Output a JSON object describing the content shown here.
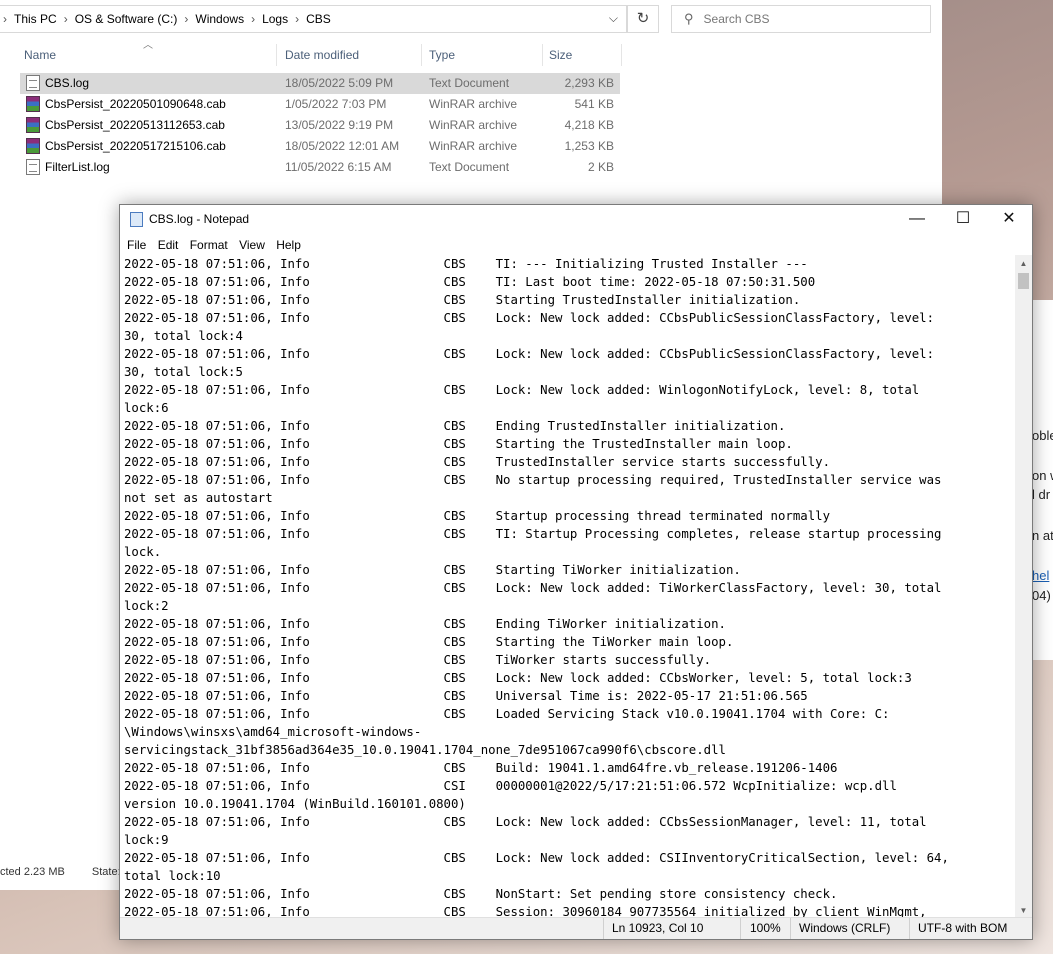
{
  "explorer": {
    "breadcrumb": [
      "This PC",
      "OS & Software (C:)",
      "Windows",
      "Logs",
      "CBS"
    ],
    "search_placeholder": "Search CBS",
    "columns": {
      "name": "Name",
      "date": "Date modified",
      "type": "Type",
      "size": "Size"
    },
    "files": [
      {
        "name": "CBS.log",
        "date": "18/05/2022 5:09 PM",
        "type": "Text Document",
        "size": "2,293 KB",
        "icon": "text-file-icon",
        "selected": true
      },
      {
        "name": "CbsPersist_20220501090648.cab",
        "date": "1/05/2022 7:03 PM",
        "type": "WinRAR archive",
        "size": "541 KB",
        "icon": "winrar-archive-icon",
        "selected": false
      },
      {
        "name": "CbsPersist_20220513112653.cab",
        "date": "13/05/2022 9:19 PM",
        "type": "WinRAR archive",
        "size": "4,218 KB",
        "icon": "winrar-archive-icon",
        "selected": false
      },
      {
        "name": "CbsPersist_20220517215106.cab",
        "date": "18/05/2022 12:01 AM",
        "type": "WinRAR archive",
        "size": "1,253 KB",
        "icon": "winrar-archive-icon",
        "selected": false
      },
      {
        "name": "FilterList.log",
        "date": "11/05/2022 6:15 AM",
        "type": "Text Document",
        "size": "2 KB",
        "icon": "text-file-icon",
        "selected": false
      }
    ],
    "status_selected": "cted  2.23 MB",
    "status_state": "State:"
  },
  "browser_peek": {
    "lines": [
      "oble",
      "on w",
      "l dr",
      "n at",
      "hel",
      "04)"
    ]
  },
  "notepad": {
    "title": "CBS.log - Notepad",
    "menu": [
      "File",
      "Edit",
      "Format",
      "View",
      "Help"
    ],
    "lines": [
      "2022-05-18 07:51:06, Info                  CBS    TI: --- Initializing Trusted Installer ---",
      "2022-05-18 07:51:06, Info                  CBS    TI: Last boot time: 2022-05-18 07:50:31.500",
      "2022-05-18 07:51:06, Info                  CBS    Starting TrustedInstaller initialization.",
      "2022-05-18 07:51:06, Info                  CBS    Lock: New lock added: CCbsPublicSessionClassFactory, level:",
      "30, total lock:4",
      "2022-05-18 07:51:06, Info                  CBS    Lock: New lock added: CCbsPublicSessionClassFactory, level:",
      "30, total lock:5",
      "2022-05-18 07:51:06, Info                  CBS    Lock: New lock added: WinlogonNotifyLock, level: 8, total",
      "lock:6",
      "2022-05-18 07:51:06, Info                  CBS    Ending TrustedInstaller initialization.",
      "2022-05-18 07:51:06, Info                  CBS    Starting the TrustedInstaller main loop.",
      "2022-05-18 07:51:06, Info                  CBS    TrustedInstaller service starts successfully.",
      "2022-05-18 07:51:06, Info                  CBS    No startup processing required, TrustedInstaller service was",
      "not set as autostart",
      "2022-05-18 07:51:06, Info                  CBS    Startup processing thread terminated normally",
      "2022-05-18 07:51:06, Info                  CBS    TI: Startup Processing completes, release startup processing",
      "lock.",
      "2022-05-18 07:51:06, Info                  CBS    Starting TiWorker initialization.",
      "2022-05-18 07:51:06, Info                  CBS    Lock: New lock added: TiWorkerClassFactory, level: 30, total",
      "lock:2",
      "2022-05-18 07:51:06, Info                  CBS    Ending TiWorker initialization.",
      "2022-05-18 07:51:06, Info                  CBS    Starting the TiWorker main loop.",
      "2022-05-18 07:51:06, Info                  CBS    TiWorker starts successfully.",
      "2022-05-18 07:51:06, Info                  CBS    Lock: New lock added: CCbsWorker, level: 5, total lock:3",
      "2022-05-18 07:51:06, Info                  CBS    Universal Time is: 2022-05-17 21:51:06.565",
      "2022-05-18 07:51:06, Info                  CBS    Loaded Servicing Stack v10.0.19041.1704 with Core: C:",
      "\\Windows\\winsxs\\amd64_microsoft-windows-",
      "servicingstack_31bf3856ad364e35_10.0.19041.1704_none_7de951067ca990f6\\cbscore.dll",
      "2022-05-18 07:51:06, Info                  CBS    Build: 19041.1.amd64fre.vb_release.191206-1406",
      "2022-05-18 07:51:06, Info                  CSI    00000001@2022/5/17:21:51:06.572 WcpInitialize: wcp.dll",
      "version 10.0.19041.1704 (WinBuild.160101.0800)",
      "2022-05-18 07:51:06, Info                  CBS    Lock: New lock added: CCbsSessionManager, level: 11, total",
      "lock:9",
      "2022-05-18 07:51:06, Info                  CBS    Lock: New lock added: CSIInventoryCriticalSection, level: 64,",
      "total lock:10",
      "2022-05-18 07:51:06, Info                  CBS    NonStart: Set pending store consistency check.",
      "2022-05-18 07:51:06, Info                  CBS    Session: 30960184_907735564 initialized by client WinMgmt,"
    ],
    "status": {
      "position": "Ln 10923, Col 10",
      "zoom": "100%",
      "line_ending": "Windows (CRLF)",
      "encoding": "UTF-8 with BOM"
    }
  }
}
